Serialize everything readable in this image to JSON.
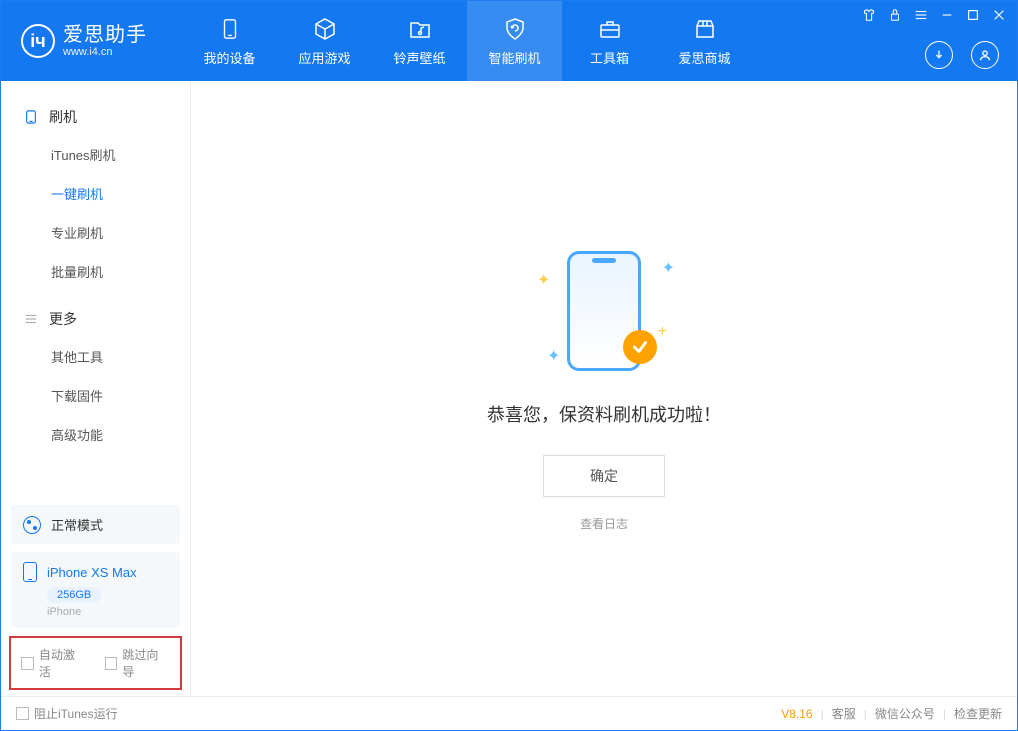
{
  "app": {
    "title": "爱思助手",
    "subtitle": "www.i4.cn"
  },
  "nav": {
    "tabs": [
      {
        "label": "我的设备"
      },
      {
        "label": "应用游戏"
      },
      {
        "label": "铃声壁纸"
      },
      {
        "label": "智能刷机"
      },
      {
        "label": "工具箱"
      },
      {
        "label": "爱思商城"
      }
    ]
  },
  "sidebar": {
    "section1": {
      "title": "刷机",
      "items": [
        "iTunes刷机",
        "一键刷机",
        "专业刷机",
        "批量刷机"
      ]
    },
    "section2": {
      "title": "更多",
      "items": [
        "其他工具",
        "下载固件",
        "高级功能"
      ]
    },
    "mode_label": "正常模式",
    "device": {
      "name": "iPhone XS Max",
      "storage": "256GB",
      "type": "iPhone"
    },
    "checkboxes": {
      "auto_activate": "自动激活",
      "skip_guide": "跳过向导"
    }
  },
  "main": {
    "success_text": "恭喜您，保资料刷机成功啦！",
    "ok_button": "确定",
    "log_link": "查看日志"
  },
  "footer": {
    "block_itunes": "阻止iTunes运行",
    "version": "V8.16",
    "links": [
      "客服",
      "微信公众号",
      "检查更新"
    ]
  }
}
